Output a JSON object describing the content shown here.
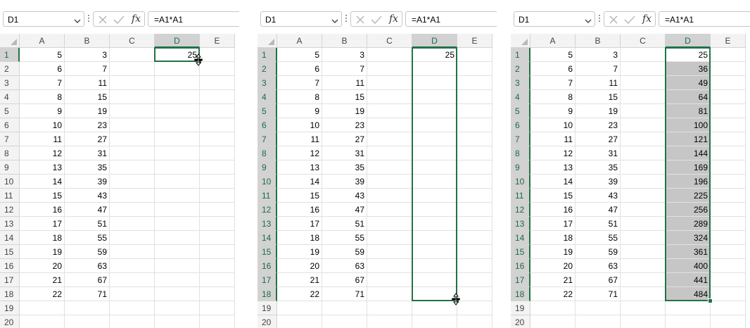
{
  "columns": [
    "A",
    "B",
    "C",
    "D",
    "E"
  ],
  "rows": [
    "1",
    "2",
    "3",
    "4",
    "5",
    "6",
    "7",
    "8",
    "9",
    "10",
    "11",
    "12",
    "13",
    "14",
    "15",
    "16",
    "17",
    "18",
    "19",
    "20"
  ],
  "col_a": [
    "5",
    "6",
    "7",
    "8",
    "9",
    "10",
    "11",
    "12",
    "13",
    "14",
    "15",
    "16",
    "17",
    "18",
    "19",
    "20",
    "21",
    "22"
  ],
  "col_b": [
    "3",
    "7",
    "11",
    "15",
    "19",
    "23",
    "27",
    "31",
    "35",
    "39",
    "43",
    "47",
    "51",
    "55",
    "59",
    "63",
    "67",
    "71"
  ],
  "colors": {
    "selection": "#217346",
    "fill": "#c6c6c6"
  },
  "panels": [
    {
      "name_box": "D1",
      "formula": "=A1*A1",
      "fx": "fx",
      "col_d": [
        "25"
      ],
      "filled": false,
      "selection_rows": 1,
      "cursor": "fill-handle-cross-icon"
    },
    {
      "name_box": "D1",
      "formula": "=A1*A1",
      "fx": "fx",
      "col_d": [
        "25"
      ],
      "filled": false,
      "selection_rows": 18,
      "cursor": "fill-handle-cross-icon"
    },
    {
      "name_box": "D1",
      "formula": "=A1*A1",
      "fx": "fx",
      "col_d": [
        "25",
        "36",
        "49",
        "64",
        "81",
        "100",
        "121",
        "144",
        "169",
        "196",
        "225",
        "256",
        "289",
        "324",
        "361",
        "400",
        "441",
        "484"
      ],
      "filled": true,
      "selection_rows": 18,
      "cursor": ""
    }
  ]
}
